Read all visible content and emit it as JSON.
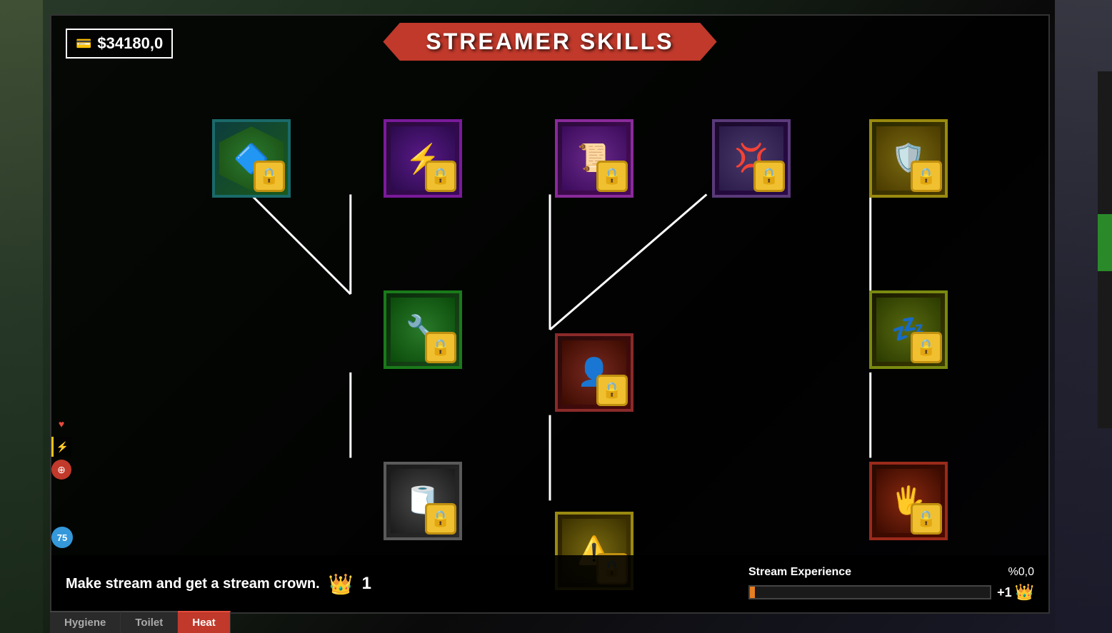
{
  "header": {
    "title": "STREAMER SKILLS"
  },
  "money": {
    "label": "$34180,0",
    "icon": "💳"
  },
  "hint": {
    "text": "Make stream and get a stream crown.",
    "crown_count": "1"
  },
  "xp": {
    "label": "Stream Experience",
    "percent": "%0,0",
    "plus_label": "+1"
  },
  "tabs": [
    {
      "label": "Hygiene",
      "active": false
    },
    {
      "label": "Toilet",
      "active": false
    },
    {
      "label": "Heat",
      "active": true
    }
  ],
  "skills": [
    {
      "id": "skill-1",
      "col": 1,
      "row": 1,
      "border": "teal",
      "icon_bg": "green-hex",
      "icon": "🔷",
      "locked": true
    },
    {
      "id": "skill-2",
      "col": 2,
      "row": 1,
      "border": "purple",
      "icon_bg": "purple-lightning",
      "icon": "⚡",
      "locked": true
    },
    {
      "id": "skill-3",
      "col": 3,
      "row": 1,
      "border": "purple-dark",
      "icon_bg": "purple-scroll",
      "icon": "📜",
      "locked": true
    },
    {
      "id": "skill-4",
      "col": 4,
      "row": 1,
      "border": "gray-purple",
      "icon_bg": "gray-scroll",
      "icon": "💢",
      "locked": true
    },
    {
      "id": "skill-5",
      "col": 5,
      "row": 1,
      "border": "gold",
      "icon_bg": "gold-shield",
      "icon": "🛡️",
      "locked": true
    },
    {
      "id": "skill-6",
      "col": 2,
      "row": 2,
      "border": "green",
      "icon_bg": "green-tool",
      "icon": "🔧",
      "locked": true
    },
    {
      "id": "skill-7",
      "col": 3,
      "row": 2.5,
      "border": "red-dark",
      "icon_bg": "red-head",
      "icon": "👤",
      "locked": true
    },
    {
      "id": "skill-8",
      "col": 5,
      "row": 2,
      "border": "olive",
      "icon_bg": "olive-z",
      "icon": "💤",
      "locked": true
    },
    {
      "id": "skill-9",
      "col": 2,
      "row": 3,
      "border": "gray",
      "icon_bg": "gray-tp",
      "icon": "🧻",
      "locked": true
    },
    {
      "id": "skill-10",
      "col": 5,
      "row": 3,
      "border": "dark-red",
      "icon_bg": "dark-red-hand",
      "icon": "🖐️",
      "locked": true
    },
    {
      "id": "skill-11",
      "col": 3,
      "row": 4,
      "border": "gold",
      "icon_bg": "yellow-bottom",
      "icon": "⚠️",
      "locked": true
    }
  ]
}
